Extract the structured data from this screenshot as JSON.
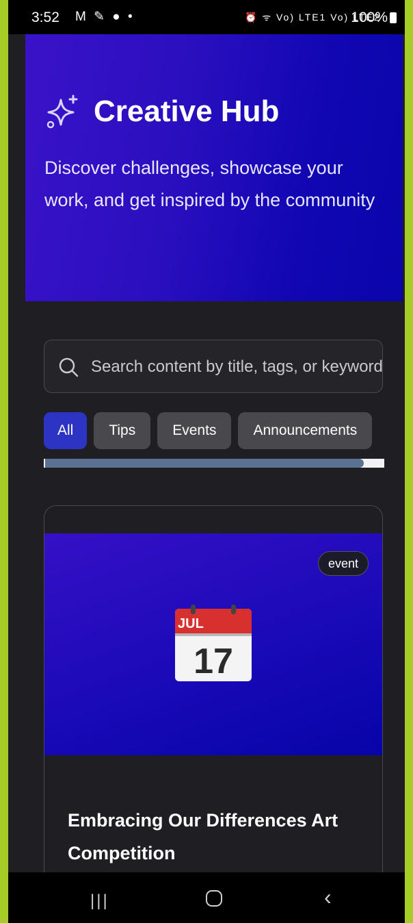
{
  "status_bar": {
    "time": "3:52",
    "left_icons": "M ✎ ● •",
    "right_icons": "⏰ ᯤ Vo) LTE1 Vo) LTE2",
    "battery": "100%"
  },
  "hero": {
    "icon": "sparkle-icon",
    "title": "Creative Hub",
    "description": "Discover challenges, showcase your work, and get inspired by the community"
  },
  "search": {
    "icon": "search-icon",
    "placeholder": "Search content by title, tags, or keywords"
  },
  "filters": [
    {
      "label": "All",
      "active": true
    },
    {
      "label": "Tips",
      "active": false
    },
    {
      "label": "Events",
      "active": false
    },
    {
      "label": "Announcements",
      "active": false
    }
  ],
  "scroll_position": 0.94,
  "card": {
    "badge": "event",
    "calendar": {
      "month": "JUL",
      "day": "17"
    },
    "title": "Embracing Our Differences Art Competition"
  },
  "nav": {
    "recents": "|||",
    "back": "‹"
  },
  "colors": {
    "accent": "#2d33c3",
    "hero_gradient_start": "#3a12c8",
    "hero_gradient_end": "#0a05ab",
    "frame": "#a6cc28"
  }
}
